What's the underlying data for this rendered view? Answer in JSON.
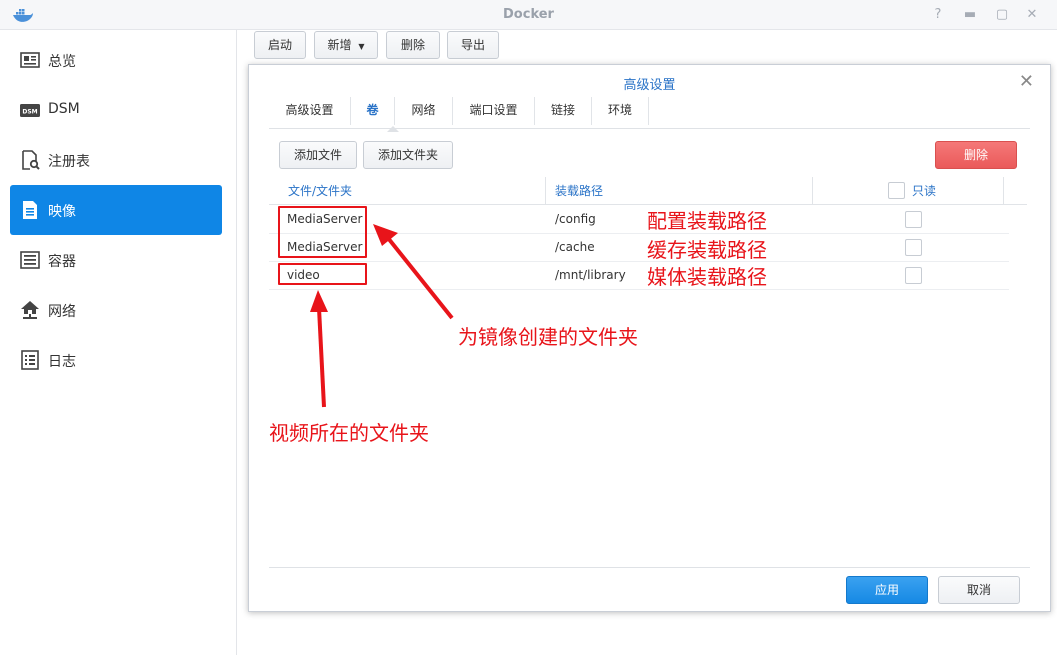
{
  "window": {
    "title": "Docker"
  },
  "sidebar": {
    "items": [
      {
        "label": "总览"
      },
      {
        "label": "DSM"
      },
      {
        "label": "注册表"
      },
      {
        "label": "映像"
      },
      {
        "label": "容器"
      },
      {
        "label": "网络"
      },
      {
        "label": "日志"
      }
    ]
  },
  "toolbar": {
    "start": "启动",
    "new": "新增",
    "delete": "删除",
    "export": "导出"
  },
  "dialog": {
    "title": "高级设置",
    "tabs": [
      {
        "label": "高级设置"
      },
      {
        "label": "卷"
      },
      {
        "label": "网络"
      },
      {
        "label": "端口设置"
      },
      {
        "label": "链接"
      },
      {
        "label": "环境"
      }
    ],
    "add_file": "添加文件",
    "add_folder": "添加文件夹",
    "delete": "删除",
    "columns": {
      "folder": "文件/文件夹",
      "mount": "装载路径",
      "readonly": "只读"
    },
    "rows": [
      {
        "folder": "MediaServer",
        "mount": "/config",
        "readonly": false
      },
      {
        "folder": "MediaServer",
        "mount": "/cache",
        "readonly": false
      },
      {
        "folder": "video",
        "mount": "/mnt/library",
        "readonly": false
      }
    ],
    "apply": "应用",
    "cancel": "取消"
  },
  "annotations": {
    "config": "配置装载路径",
    "cache": "缓存装载路径",
    "media": "媒体装载路径",
    "created_folder": "为镜像创建的文件夹",
    "video_folder": "视频所在的文件夹",
    "color": "#e8141a"
  }
}
